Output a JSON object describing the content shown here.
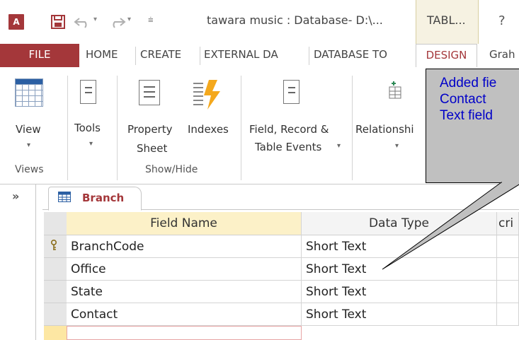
{
  "titlebar": {
    "app_icon": "A⃣",
    "app_icon_letter": "A",
    "title": "tawara music : Database- D:\\...",
    "context_tab": "TABL...",
    "help": "?"
  },
  "tabs": [
    {
      "label": "FILE",
      "active": false
    },
    {
      "label": "HOME",
      "active": false
    },
    {
      "label": "CREATE",
      "active": false
    },
    {
      "label": "EXTERNAL DA",
      "active": false
    },
    {
      "label": "DATABASE TO",
      "active": false
    },
    {
      "label": "DESIGN",
      "active": true
    },
    {
      "label": "Grah",
      "active": false
    }
  ],
  "ribbon": {
    "view_label": "View",
    "tools_label": "Tools",
    "property_sheet_label_1": "Property",
    "property_sheet_label_2": "Sheet",
    "indexes_label": "Indexes",
    "events_label_1": "Field, Record &",
    "events_label_2": "Table Events",
    "relationships_label": "Relationshi",
    "groups": {
      "views": "Views",
      "show_hide": "Show/Hide"
    }
  },
  "nav": {
    "toggle": "»"
  },
  "document": {
    "tab_label": "Branch",
    "columns": {
      "field_name": "Field Name",
      "data_type": "Data Type",
      "description": "cri"
    },
    "rows": [
      {
        "field": "BranchCode",
        "type": "Short Text",
        "primary_key": true
      },
      {
        "field": "Office",
        "type": "Short Text",
        "primary_key": false
      },
      {
        "field": "State",
        "type": "Short Text",
        "primary_key": false
      },
      {
        "field": "Contact",
        "type": "Short Text",
        "primary_key": false
      }
    ]
  },
  "callout": {
    "line1": "Added fie",
    "line2": "Contact",
    "line3": "Text field"
  },
  "colors": {
    "access_red": "#a4373a",
    "callout_bg": "#c0c0c0",
    "callout_text": "#0000c8"
  }
}
